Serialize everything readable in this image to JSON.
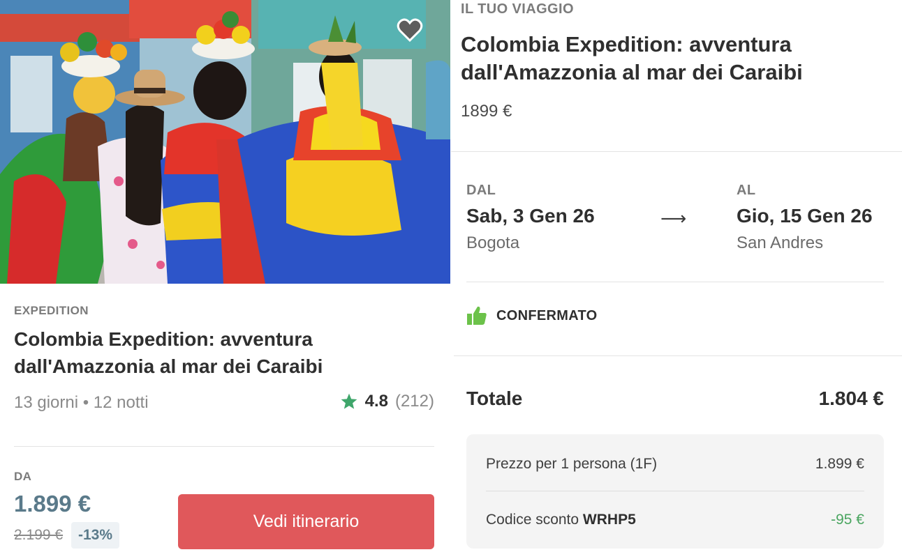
{
  "card": {
    "type_label": "EXPEDITION",
    "title": "Colombia Expedition: avventura dall'Amazzonia al mar dei Caraibi",
    "duration": "13 giorni • 12 notti",
    "rating": {
      "score": "4.8",
      "count": "(212)"
    },
    "price": {
      "from_label": "DA",
      "current": "1.899 €",
      "original": "2.199 €",
      "discount": "-13%"
    },
    "cta_label": "Vedi itinerario"
  },
  "summary": {
    "eyebrow": "IL TUO VIAGGIO",
    "title": "Colombia Expedition: avventura dall'Amazzonia al mar dei Caraibi",
    "price": "1899 €",
    "from": {
      "label": "DAL",
      "date": "Sab, 3 Gen 26",
      "city": "Bogota"
    },
    "arrow": "⟶",
    "to": {
      "label": "AL",
      "date": "Gio, 15 Gen 26",
      "city": "San Andres"
    },
    "status": "CONFERMATO",
    "total": {
      "label": "Totale",
      "value": "1.804 €"
    },
    "breakdown": {
      "row1": {
        "label": "Prezzo per 1 persona (1F)",
        "value": "1.899 €"
      },
      "row2": {
        "label_prefix": "Codice sconto ",
        "code": "WRHP5",
        "value": "-95 €"
      }
    }
  },
  "icons": {
    "favorite": "heart-icon",
    "rating": "star-icon",
    "status": "thumbs-up-icon"
  },
  "colors": {
    "accent": "#e0585b",
    "price_blue": "#5a7a8a",
    "success": "#4aa560",
    "star": "#3fa66b",
    "thumb": "#6cc24a"
  }
}
